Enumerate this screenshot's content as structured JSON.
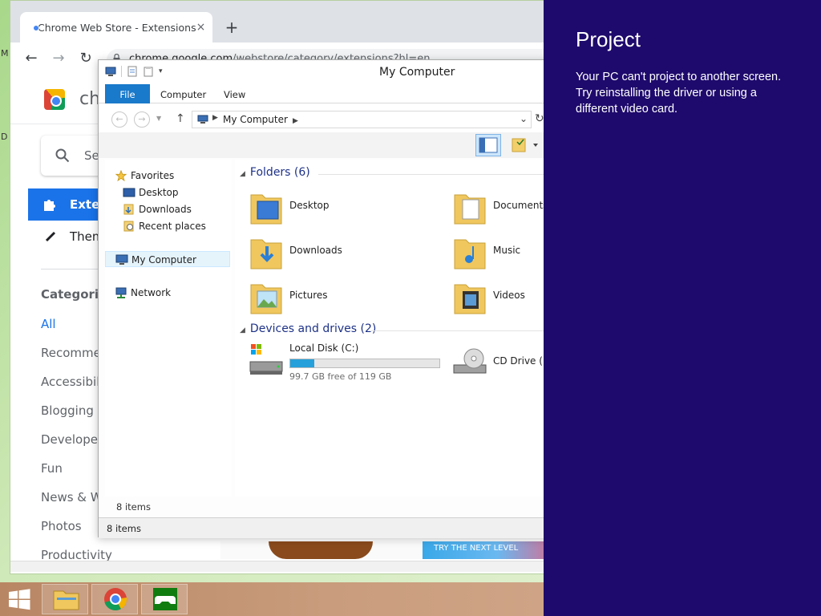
{
  "desktop": {
    "edge_glyph_top": "M",
    "edge_glyph_mid": "D"
  },
  "chrome": {
    "tab_title": "Chrome Web Store - Extensions",
    "tab_close": "×",
    "new_tab": "+",
    "nav_back": "←",
    "nav_forward": "→",
    "nav_reload": "↻",
    "url_host": "chrome.google.com",
    "url_path": "/webstore/category/extensions?hl=en",
    "brand": "chr",
    "search_placeholder": "Se",
    "nav_extensions": "Exten",
    "nav_themes": "Them",
    "categories_title": "Categories",
    "categories": [
      {
        "label": "All",
        "active": true
      },
      {
        "label": "Recommen"
      },
      {
        "label": "Accessibilit"
      },
      {
        "label": "Blogging"
      },
      {
        "label": "Developer T"
      },
      {
        "label": "Fun"
      },
      {
        "label": "News & We"
      },
      {
        "label": "Photos"
      },
      {
        "label": "Productivity"
      }
    ],
    "banner_text": "TRY THE NEXT LEVEL"
  },
  "explorer": {
    "title": "My Computer",
    "ribbon_tabs": [
      "File",
      "Computer",
      "View"
    ],
    "address": "My Computer",
    "nav": {
      "favorites": "Favorites",
      "fav_items": [
        "Desktop",
        "Downloads",
        "Recent places"
      ],
      "my_computer": "My Computer",
      "network": "Network"
    },
    "folders_header": "Folders (6)",
    "folders": [
      "Desktop",
      "Documents",
      "Downloads",
      "Music",
      "Pictures",
      "Videos"
    ],
    "devices_header": "Devices and drives (2)",
    "drive_c": {
      "label": "Local Disk (C:)",
      "free_text": "99.7 GB free of 119 GB",
      "used_fraction": 0.162
    },
    "drive_d": {
      "label": "CD Drive (D:"
    },
    "item_count": "8 items",
    "status_text": "8 items"
  },
  "project": {
    "title": "Project",
    "message": "Your PC can't project to another screen. Try reinstalling the driver or using a different video card."
  },
  "colors": {
    "project_bg": "#1e0a6c",
    "file_tab": "#1979ca",
    "drive_fill": "#26a0da",
    "ws_accent": "#1a73e8"
  }
}
